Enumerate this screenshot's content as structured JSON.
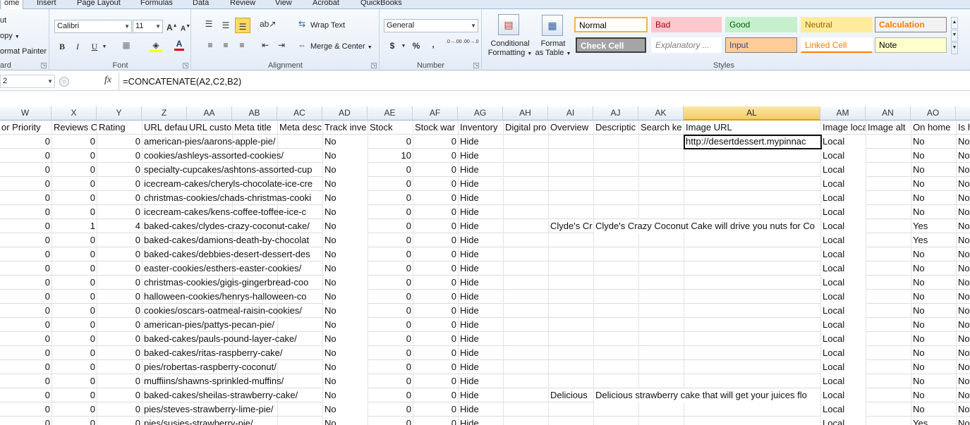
{
  "tabs": [
    "ome",
    "Insert",
    "Page Layout",
    "Formulas",
    "Data",
    "Review",
    "View",
    "Acrobat",
    "QuickBooks"
  ],
  "clipboard": {
    "cut": "ut",
    "copy": "opy",
    "format_painter": "ormat Painter",
    "label": "ard"
  },
  "font": {
    "name": "Calibri",
    "size": "11",
    "label": "Font",
    "grow": "A",
    "shrink": "A",
    "bold": "B",
    "italic": "I",
    "underline": "U"
  },
  "alignment": {
    "wrap_text": "Wrap Text",
    "merge_center": "Merge & Center",
    "label": "Alignment"
  },
  "number": {
    "format": "General",
    "currency": "$",
    "percent": "%",
    "comma": ",",
    "inc_decimal": ".0→.00",
    "dec_decimal": ".00→.0",
    "label": "Number"
  },
  "styles_group": {
    "conditional_formatting": "Conditional\nFormatting",
    "conditional_line1": "Conditional",
    "conditional_line2": "Formatting",
    "format_table_line1": "Format",
    "format_table_line2": "as Table",
    "label": "Styles",
    "cells": [
      {
        "name": "Normal",
        "bg": "#ffffff",
        "fg": "#000000"
      },
      {
        "name": "Bad",
        "bg": "#ffc7ce",
        "fg": "#9c0006"
      },
      {
        "name": "Good",
        "bg": "#c6efce",
        "fg": "#006100"
      },
      {
        "name": "Neutral",
        "bg": "#ffeb9c",
        "fg": "#9c6500"
      },
      {
        "name": "Calculation",
        "bg": "#f2f2f2",
        "fg": "#fa7d00"
      },
      {
        "name": "Check Cell",
        "bg": "#a5a5a5",
        "fg": "#ffffff"
      },
      {
        "name": "Explanatory ...",
        "bg": "#ffffff",
        "fg": "#7f7f7f"
      },
      {
        "name": "Input",
        "bg": "#ffcc99",
        "fg": "#3f3f76"
      },
      {
        "name": "Linked Cell",
        "bg": "#ffffff",
        "fg": "#fa7d00"
      },
      {
        "name": "Note",
        "bg": "#ffffcc",
        "fg": "#000000"
      }
    ]
  },
  "formula_bar": {
    "name_box": "2",
    "fx": "fx",
    "formula": "=CONCATENATE(A2,C2,B2)"
  },
  "columns": [
    "W",
    "X",
    "Y",
    "Z",
    "AA",
    "AB",
    "AC",
    "AD",
    "AE",
    "AF",
    "AG",
    "AH",
    "AI",
    "AJ",
    "AK",
    "AL",
    "AM",
    "AN",
    "AO",
    ""
  ],
  "header_row": [
    "or Priority",
    "Reviews C",
    "Rating",
    "URL defau",
    "URL custo",
    "Meta title",
    "Meta desc",
    "Track inve",
    "Stock",
    "Stock war",
    "Inventory",
    "Digital pro",
    "Overview",
    "Descriptic",
    "Search ke",
    "Image URL",
    "Image loca",
    "Image alt",
    "On home",
    "Is h"
  ],
  "rows": [
    {
      "w": "0",
      "x": "0",
      "y": "0",
      "z": "american-pies/aarons-apple-pie/",
      "ad": "No",
      "ae": "0",
      "af": "0",
      "ag": "Hide",
      "ai": "",
      "aj": "",
      "al": "http://desertdessert.mypinnac",
      "am": "Local",
      "ao": "No",
      "ap": "No"
    },
    {
      "w": "0",
      "x": "0",
      "y": "0",
      "z": "cookies/ashleys-assorted-cookies/",
      "ad": "No",
      "ae": "10",
      "af": "0",
      "ag": "Hide",
      "ai": "",
      "aj": "",
      "al": "",
      "am": "Local",
      "ao": "No",
      "ap": "No"
    },
    {
      "w": "0",
      "x": "0",
      "y": "0",
      "z": "specialty-cupcakes/ashtons-assorted-cup",
      "ad": "No",
      "ae": "0",
      "af": "0",
      "ag": "Hide",
      "ai": "",
      "aj": "",
      "al": "",
      "am": "Local",
      "ao": "No",
      "ap": "No"
    },
    {
      "w": "0",
      "x": "0",
      "y": "0",
      "z": "icecream-cakes/cheryls-chocolate-ice-cre",
      "ad": "No",
      "ae": "0",
      "af": "0",
      "ag": "Hide",
      "ai": "",
      "aj": "",
      "al": "",
      "am": "Local",
      "ao": "No",
      "ap": "No"
    },
    {
      "w": "0",
      "x": "0",
      "y": "0",
      "z": "christmas-cookies/chads-christmas-cooki",
      "ad": "No",
      "ae": "0",
      "af": "0",
      "ag": "Hide",
      "ai": "",
      "aj": "",
      "al": "",
      "am": "Local",
      "ao": "No",
      "ap": "No"
    },
    {
      "w": "0",
      "x": "0",
      "y": "0",
      "z": "icecream-cakes/kens-coffee-toffee-ice-c",
      "ad": "No",
      "ae": "0",
      "af": "0",
      "ag": "Hide",
      "ai": "",
      "aj": "",
      "al": "",
      "am": "Local",
      "ao": "No",
      "ap": "No"
    },
    {
      "w": "0",
      "x": "1",
      "y": "4",
      "z": "baked-cakes/clydes-crazy-coconut-cake/",
      "ad": "No",
      "ae": "0",
      "af": "0",
      "ag": "Hide",
      "ai": "Clyde's Cr",
      "aj": "Clyde's Crazy Coconut Cake will drive you nuts for Co",
      "al": "",
      "am": "Local",
      "ao": "Yes",
      "ap": "No"
    },
    {
      "w": "0",
      "x": "0",
      "y": "0",
      "z": "baked-cakes/damions-death-by-chocolat",
      "ad": "No",
      "ae": "0",
      "af": "0",
      "ag": "Hide",
      "ai": "",
      "aj": "",
      "al": "",
      "am": "Local",
      "ao": "Yes",
      "ap": "No"
    },
    {
      "w": "0",
      "x": "0",
      "y": "0",
      "z": "baked-cakes/debbies-desert-dessert-des",
      "ad": "No",
      "ae": "0",
      "af": "0",
      "ag": "Hide",
      "ai": "",
      "aj": "",
      "al": "",
      "am": "Local",
      "ao": "No",
      "ap": "No"
    },
    {
      "w": "0",
      "x": "0",
      "y": "0",
      "z": "easter-cookies/esthers-easter-cookies/",
      "ad": "No",
      "ae": "0",
      "af": "0",
      "ag": "Hide",
      "ai": "",
      "aj": "",
      "al": "",
      "am": "Local",
      "ao": "No",
      "ap": "No"
    },
    {
      "w": "0",
      "x": "0",
      "y": "0",
      "z": "christmas-cookies/gigis-gingerbread-coo",
      "ad": "No",
      "ae": "0",
      "af": "0",
      "ag": "Hide",
      "ai": "",
      "aj": "",
      "al": "",
      "am": "Local",
      "ao": "No",
      "ap": "No"
    },
    {
      "w": "0",
      "x": "0",
      "y": "0",
      "z": "halloween-cookies/henrys-halloween-co",
      "ad": "No",
      "ae": "0",
      "af": "0",
      "ag": "Hide",
      "ai": "",
      "aj": "",
      "al": "",
      "am": "Local",
      "ao": "No",
      "ap": "No"
    },
    {
      "w": "0",
      "x": "0",
      "y": "0",
      "z": "cookies/oscars-oatmeal-raisin-cookies/",
      "ad": "No",
      "ae": "0",
      "af": "0",
      "ag": "Hide",
      "ai": "",
      "aj": "",
      "al": "",
      "am": "Local",
      "ao": "No",
      "ap": "No"
    },
    {
      "w": "0",
      "x": "0",
      "y": "0",
      "z": "american-pies/pattys-pecan-pie/",
      "ad": "No",
      "ae": "0",
      "af": "0",
      "ag": "Hide",
      "ai": "",
      "aj": "",
      "al": "",
      "am": "Local",
      "ao": "No",
      "ap": "No"
    },
    {
      "w": "0",
      "x": "0",
      "y": "0",
      "z": "baked-cakes/pauls-pound-layer-cake/",
      "ad": "No",
      "ae": "0",
      "af": "0",
      "ag": "Hide",
      "ai": "",
      "aj": "",
      "al": "",
      "am": "Local",
      "ao": "No",
      "ap": "No"
    },
    {
      "w": "0",
      "x": "0",
      "y": "0",
      "z": "baked-cakes/ritas-raspberry-cake/",
      "ad": "No",
      "ae": "0",
      "af": "0",
      "ag": "Hide",
      "ai": "",
      "aj": "",
      "al": "",
      "am": "Local",
      "ao": "No",
      "ap": "No"
    },
    {
      "w": "0",
      "x": "0",
      "y": "0",
      "z": "pies/robertas-raspberry-coconut/",
      "ad": "No",
      "ae": "0",
      "af": "0",
      "ag": "Hide",
      "ai": "",
      "aj": "",
      "al": "",
      "am": "Local",
      "ao": "No",
      "ap": "No"
    },
    {
      "w": "0",
      "x": "0",
      "y": "0",
      "z": "muffiins/shawns-sprinkled-muffins/",
      "ad": "No",
      "ae": "0",
      "af": "0",
      "ag": "Hide",
      "ai": "",
      "aj": "",
      "al": "",
      "am": "Local",
      "ao": "No",
      "ap": "No"
    },
    {
      "w": "0",
      "x": "0",
      "y": "0",
      "z": "baked-cakes/sheilas-strawberry-cake/",
      "ad": "No",
      "ae": "0",
      "af": "0",
      "ag": "Hide",
      "ai": "Delicious",
      "aj": "Delicious strawberry cake that will get your juices flo",
      "al": "",
      "am": "Local",
      "ao": "No",
      "ap": "No"
    },
    {
      "w": "0",
      "x": "0",
      "y": "0",
      "z": "pies/steves-strawberry-lime-pie/",
      "ad": "No",
      "ae": "0",
      "af": "0",
      "ag": "Hide",
      "ai": "",
      "aj": "",
      "al": "",
      "am": "Local",
      "ao": "No",
      "ap": "No"
    },
    {
      "w": "0",
      "x": "0",
      "y": "0",
      "z": "pies/susies-strawberry-pie/",
      "ad": "No",
      "ae": "0",
      "af": "0",
      "ag": "Hide",
      "ai": "",
      "aj": "",
      "al": "",
      "am": "Local",
      "ao": "Yes",
      "ap": "No"
    }
  ],
  "selected_column": "AL"
}
